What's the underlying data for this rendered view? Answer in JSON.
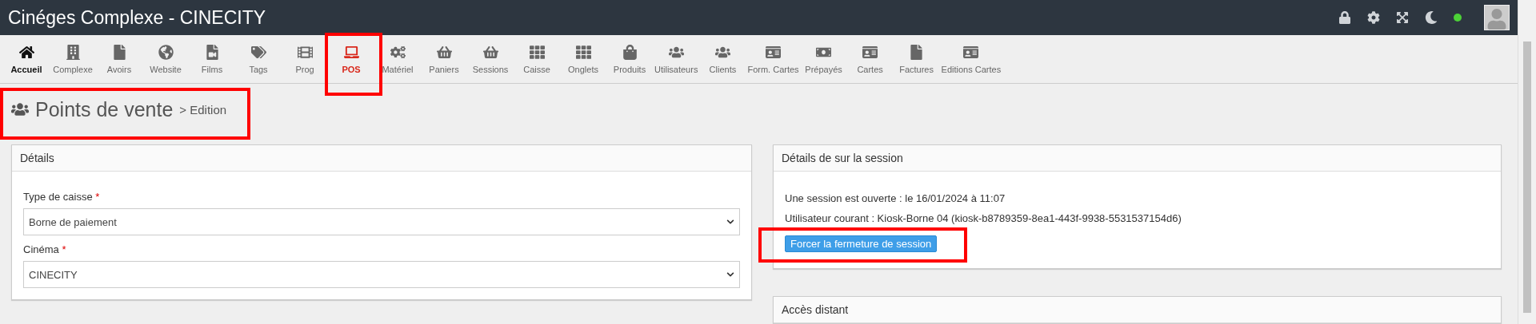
{
  "header": {
    "title": "Cinéges Complexe - CINECITY",
    "status_online": true
  },
  "nav": [
    {
      "label": "Accueil",
      "kind": "home",
      "selected": false,
      "highlighted": false
    },
    {
      "label": "Complexe",
      "kind": "link",
      "selected": false,
      "highlighted": false
    },
    {
      "label": "Avoirs",
      "kind": "link",
      "selected": false,
      "highlighted": false
    },
    {
      "label": "Website",
      "kind": "link",
      "selected": false,
      "highlighted": false
    },
    {
      "label": "Films",
      "kind": "link",
      "selected": false,
      "highlighted": false
    },
    {
      "label": "Tags",
      "kind": "link",
      "selected": false,
      "highlighted": false
    },
    {
      "label": "Prog",
      "kind": "link",
      "selected": false,
      "highlighted": false
    },
    {
      "label": "POS",
      "kind": "link",
      "selected": true,
      "highlighted": true
    },
    {
      "label": "Matériel",
      "kind": "link",
      "selected": false,
      "highlighted": false
    },
    {
      "label": "Paniers",
      "kind": "link",
      "selected": false,
      "highlighted": false
    },
    {
      "label": "Sessions",
      "kind": "link",
      "selected": false,
      "highlighted": false
    },
    {
      "label": "Caisse",
      "kind": "link",
      "selected": false,
      "highlighted": false
    },
    {
      "label": "Onglets",
      "kind": "link",
      "selected": false,
      "highlighted": false
    },
    {
      "label": "Produits",
      "kind": "link",
      "selected": false,
      "highlighted": false
    },
    {
      "label": "Utilisateurs",
      "kind": "link",
      "selected": false,
      "highlighted": false
    },
    {
      "label": "Clients",
      "kind": "link",
      "selected": false,
      "highlighted": false
    },
    {
      "label": "Form. Cartes",
      "kind": "link",
      "selected": false,
      "highlighted": false
    },
    {
      "label": "Prépayés",
      "kind": "link",
      "selected": false,
      "highlighted": false
    },
    {
      "label": "Cartes",
      "kind": "link",
      "selected": false,
      "highlighted": false
    },
    {
      "label": "Factures",
      "kind": "link",
      "selected": false,
      "highlighted": false
    },
    {
      "label": "Editions Cartes",
      "kind": "link",
      "selected": false,
      "highlighted": false
    }
  ],
  "page_title": {
    "title": "Points de vente",
    "subtitle": "> Edition",
    "highlighted": true
  },
  "details": {
    "title": "Détails",
    "fields": [
      {
        "label": "Type de caisse",
        "required_mark": "*",
        "value": "Borne de paiement"
      },
      {
        "label": "Cinéma",
        "required_mark": "*",
        "value": "CINECITY"
      }
    ]
  },
  "session": {
    "title": "Détails de sur la session",
    "lines": [
      "Une session est ouverte : le 16/01/2024 à 11:07",
      "Utilisateur courant : Kiosk-Borne 04 (kiosk-b8789359-8ea1-443f-9938-5531537154d6)"
    ],
    "button": {
      "label": "Forcer la fermeture de session",
      "highlighted": true
    }
  },
  "remote": {
    "title": "Accès distant"
  }
}
